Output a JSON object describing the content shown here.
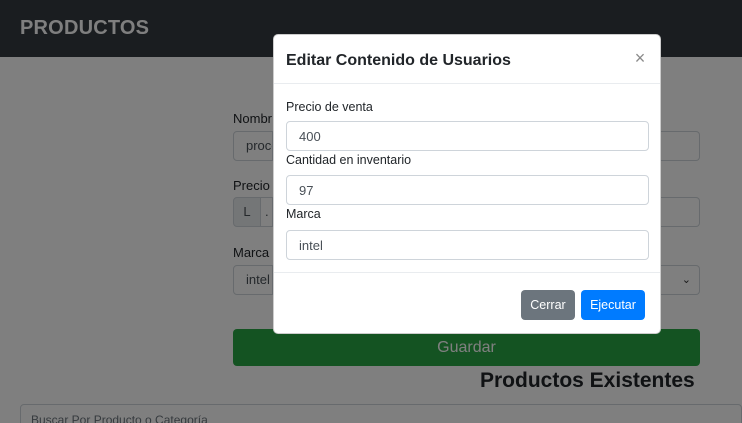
{
  "navbar": {
    "brand": "PRODUCTOS"
  },
  "form": {
    "nombre_label": "Nombr",
    "nombre_value": "proce",
    "precio_label": "Precio",
    "precio_prefix": "L",
    "precio_value": ".",
    "marca_label": "Marca",
    "marca_value": "intel",
    "guardar_label": "Guardar"
  },
  "section": {
    "title": "Productos Existentes"
  },
  "search": {
    "placeholder": "Buscar Por Producto o Categoría"
  },
  "modal": {
    "title": "Editar Contenido de Usuarios",
    "close_symbol": "×",
    "fields": [
      {
        "label": "Precio de venta",
        "value": "400"
      },
      {
        "label": "Cantidad en inventario",
        "value": "97"
      },
      {
        "label": "Marca",
        "value": "intel"
      }
    ],
    "cerrar_label": "Cerrar",
    "ejecutar_label": "Ejecutar"
  },
  "colors": {
    "navbar": "#343a40",
    "guardar": "#28a745",
    "primary": "#007bff",
    "secondary": "#6c757d"
  }
}
